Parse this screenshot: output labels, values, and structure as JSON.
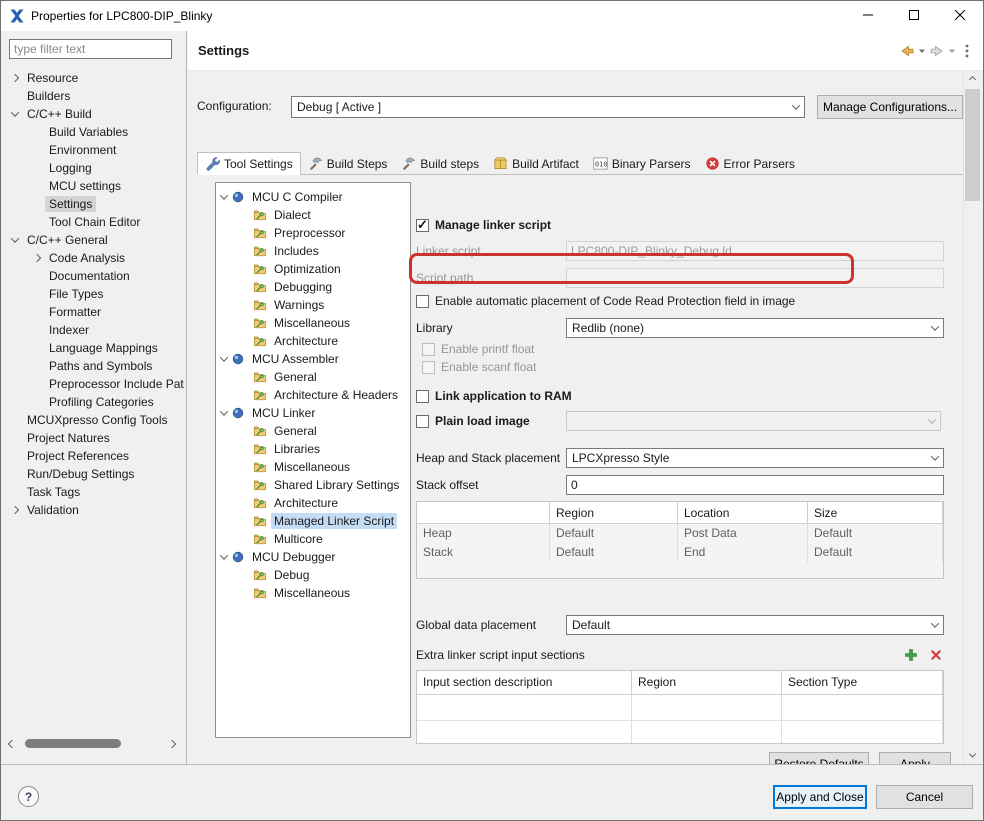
{
  "window": {
    "title": "Properties for LPC800-DIP_Blinky"
  },
  "header": {
    "title": "Settings"
  },
  "sidebar": {
    "filter_placeholder": "type filter text",
    "tree": [
      {
        "label": "Resource",
        "level": 0,
        "arrow": "collapsed"
      },
      {
        "label": "Builders",
        "level": 0,
        "arrow": "none"
      },
      {
        "label": "C/C++ Build",
        "level": 0,
        "arrow": "expanded"
      },
      {
        "label": "Build Variables",
        "level": 1,
        "arrow": "none"
      },
      {
        "label": "Environment",
        "level": 1,
        "arrow": "none"
      },
      {
        "label": "Logging",
        "level": 1,
        "arrow": "none"
      },
      {
        "label": "MCU settings",
        "level": 1,
        "arrow": "none"
      },
      {
        "label": "Settings",
        "level": 1,
        "arrow": "none",
        "selected": true
      },
      {
        "label": "Tool Chain Editor",
        "level": 1,
        "arrow": "none"
      },
      {
        "label": "C/C++ General",
        "level": 0,
        "arrow": "expanded"
      },
      {
        "label": "Code Analysis",
        "level": 1,
        "arrow": "collapsed"
      },
      {
        "label": "Documentation",
        "level": 1,
        "arrow": "none"
      },
      {
        "label": "File Types",
        "level": 1,
        "arrow": "none"
      },
      {
        "label": "Formatter",
        "level": 1,
        "arrow": "none"
      },
      {
        "label": "Indexer",
        "level": 1,
        "arrow": "none"
      },
      {
        "label": "Language Mappings",
        "level": 1,
        "arrow": "none"
      },
      {
        "label": "Paths and Symbols",
        "level": 1,
        "arrow": "none"
      },
      {
        "label": "Preprocessor Include Pat",
        "level": 1,
        "arrow": "none"
      },
      {
        "label": "Profiling Categories",
        "level": 1,
        "arrow": "none"
      },
      {
        "label": "MCUXpresso Config Tools",
        "level": 0,
        "arrow": "none"
      },
      {
        "label": "Project Natures",
        "level": 0,
        "arrow": "none"
      },
      {
        "label": "Project References",
        "level": 0,
        "arrow": "none"
      },
      {
        "label": "Run/Debug Settings",
        "level": 0,
        "arrow": "none"
      },
      {
        "label": "Task Tags",
        "level": 0,
        "arrow": "none"
      },
      {
        "label": "Validation",
        "level": 0,
        "arrow": "collapsed"
      }
    ]
  },
  "configuration": {
    "label": "Configuration:",
    "value": "Debug  [ Active ]",
    "manage_button": "Manage Configurations..."
  },
  "tabs": [
    {
      "label": "Tool Settings",
      "icon": "wrench",
      "active": true
    },
    {
      "label": "Build Steps",
      "icon": "hammer",
      "active": false
    },
    {
      "label": "Build steps",
      "icon": "hammer",
      "active": false
    },
    {
      "label": "Build Artifact",
      "icon": "package",
      "active": false
    },
    {
      "label": "Binary Parsers",
      "icon": "binary",
      "active": false
    },
    {
      "label": "Error Parsers",
      "icon": "error",
      "active": false
    }
  ],
  "tool_tree": [
    {
      "label": "MCU C Compiler",
      "type": "group"
    },
    {
      "label": "Dialect",
      "type": "item"
    },
    {
      "label": "Preprocessor",
      "type": "item"
    },
    {
      "label": "Includes",
      "type": "item"
    },
    {
      "label": "Optimization",
      "type": "item"
    },
    {
      "label": "Debugging",
      "type": "item"
    },
    {
      "label": "Warnings",
      "type": "item"
    },
    {
      "label": "Miscellaneous",
      "type": "item"
    },
    {
      "label": "Architecture",
      "type": "item"
    },
    {
      "label": "MCU Assembler",
      "type": "group"
    },
    {
      "label": "General",
      "type": "item"
    },
    {
      "label": "Architecture & Headers",
      "type": "item"
    },
    {
      "label": "MCU Linker",
      "type": "group"
    },
    {
      "label": "General",
      "type": "item"
    },
    {
      "label": "Libraries",
      "type": "item"
    },
    {
      "label": "Miscellaneous",
      "type": "item"
    },
    {
      "label": "Shared Library Settings",
      "type": "item"
    },
    {
      "label": "Architecture",
      "type": "item"
    },
    {
      "label": "Managed Linker Script",
      "type": "item",
      "selected": true
    },
    {
      "label": "Multicore",
      "type": "item"
    },
    {
      "label": "MCU Debugger",
      "type": "group"
    },
    {
      "label": "Debug",
      "type": "item"
    },
    {
      "label": "Miscellaneous",
      "type": "item"
    }
  ],
  "options": {
    "manage_linker_script": {
      "label": "Manage linker script",
      "checked": true
    },
    "linker_script": {
      "label": "Linker script",
      "value": "LPC800-DIP_Blinky_Debug.ld"
    },
    "script_path": {
      "label": "Script path",
      "value": ""
    },
    "crp": {
      "label": "Enable automatic placement of Code Read Protection field in image",
      "checked": false
    },
    "library": {
      "label": "Library",
      "value": "Redlib (none)"
    },
    "printf_float": {
      "label": "Enable printf float",
      "checked": false
    },
    "scanf_float": {
      "label": "Enable scanf float",
      "checked": false
    },
    "link_ram": {
      "label": "Link application to RAM",
      "checked": false
    },
    "plain_load": {
      "label": "Plain load image",
      "checked": false
    },
    "heap_stack": {
      "label": "Heap and Stack placement",
      "value": "LPCXpresso Style"
    },
    "stack_offset": {
      "label": "Stack offset",
      "value": "0"
    },
    "heap_table": {
      "headers": [
        "",
        "Region",
        "Location",
        "Size"
      ],
      "rows": [
        [
          "Heap",
          "Default",
          "Post Data",
          "Default"
        ],
        [
          "Stack",
          "Default",
          "End",
          "Default"
        ]
      ]
    },
    "global_data": {
      "label": "Global data placement",
      "value": "Default"
    },
    "extra_sections": {
      "label": "Extra linker script input sections",
      "headers": [
        "Input section description",
        "Region",
        "Section Type"
      ]
    }
  },
  "buttons": {
    "restore_defaults": "Restore Defaults",
    "apply": "Apply",
    "apply_close": "Apply and Close",
    "cancel": "Cancel"
  },
  "colors": {
    "annotation_red": "#cf3131",
    "selection_blue": "#c4ddf5",
    "default_button_border": "#0078d7"
  }
}
